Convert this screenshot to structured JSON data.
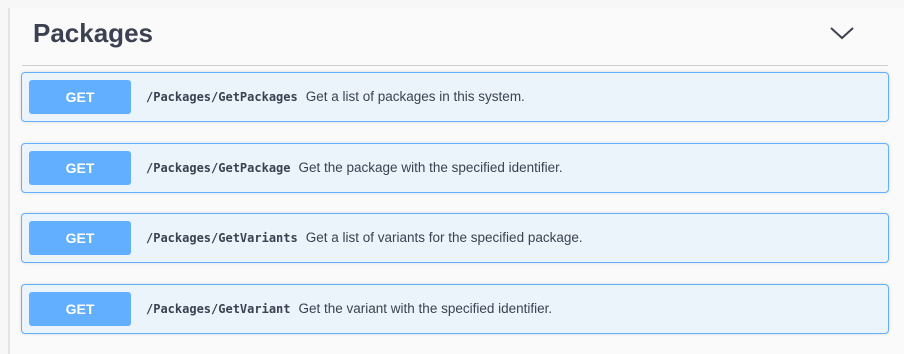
{
  "section": {
    "title": "Packages",
    "toggle_icon": "chevron-down-icon"
  },
  "operations": [
    {
      "method": "GET",
      "path": "/Packages/GetPackages",
      "summary": "Get a list of packages in this system."
    },
    {
      "method": "GET",
      "path": "/Packages/GetPackage",
      "summary": "Get the package with the specified identifier."
    },
    {
      "method": "GET",
      "path": "/Packages/GetVariants",
      "summary": "Get a list of variants for the specified package."
    },
    {
      "method": "GET",
      "path": "/Packages/GetVariant",
      "summary": "Get the variant with the specified identifier."
    }
  ],
  "colors": {
    "get_accent": "#61affe",
    "get_background": "#ebf3fb",
    "text": "#3b4151"
  }
}
